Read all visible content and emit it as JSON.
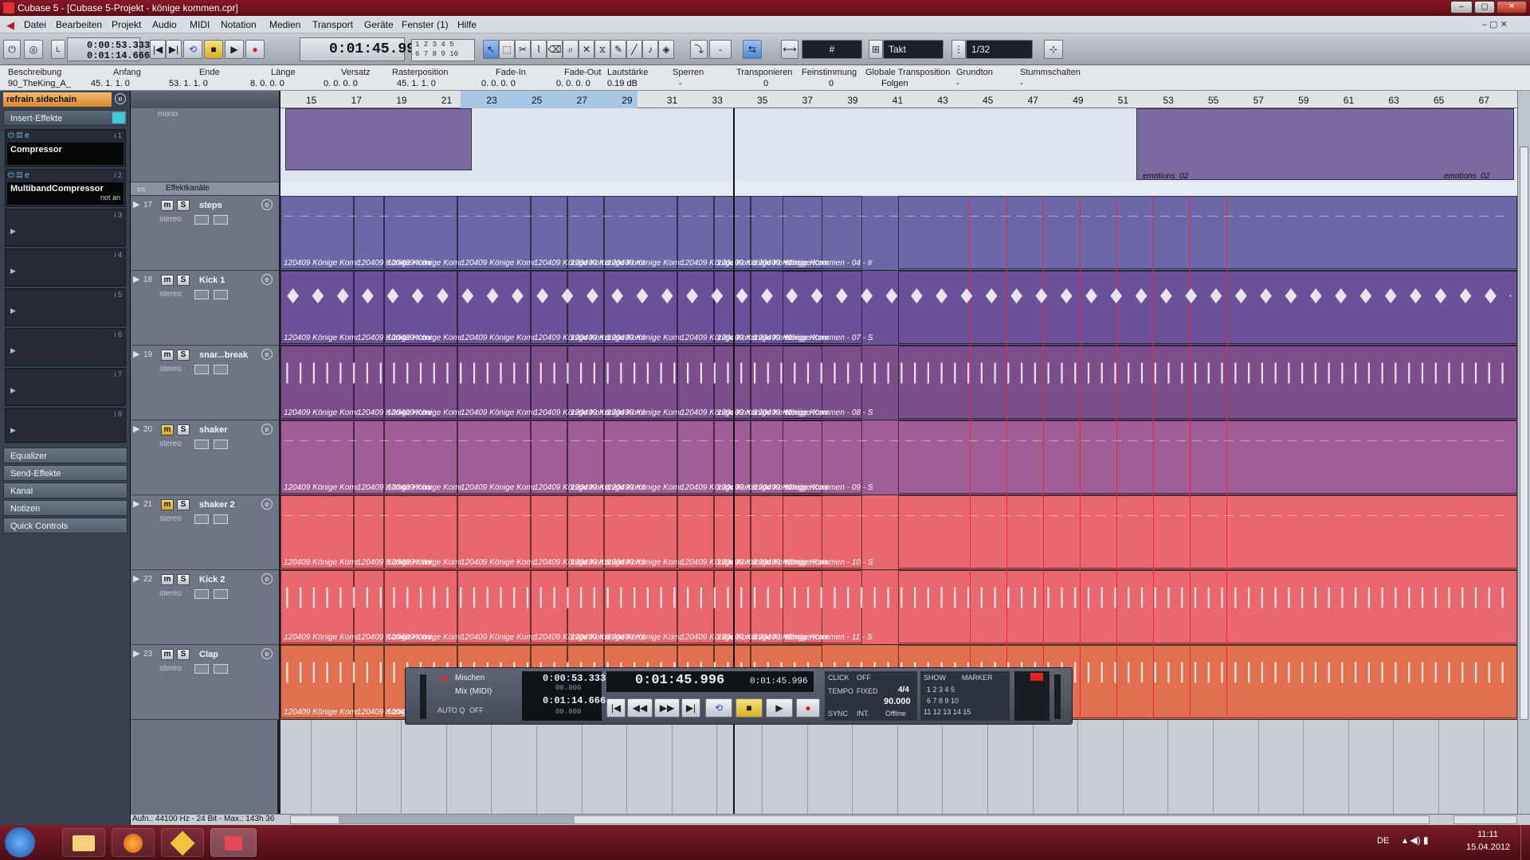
{
  "window": {
    "title": "Cubase 5 - [Cubase 5-Projekt - könige kommen.cpr]"
  },
  "menu": [
    "Datei",
    "Bearbeiten",
    "Projekt",
    "Audio",
    "MIDI",
    "Notation",
    "Medien",
    "Transport",
    "Geräte",
    "Fenster (1)",
    "Hilfe"
  ],
  "toolbar": {
    "pos_left_top": "0:00:53.333",
    "pos_left_bottom": "0:01:14.666",
    "main_time": "0:01:45.996",
    "num_grid_top": "1 2 3 4 5",
    "num_grid_bottom": "6 7 8 9 10",
    "snap_mode": "Takt",
    "quantize": "1/32",
    "nudge": "-"
  },
  "infoline": {
    "headers": [
      "Beschreibung",
      "Anfang",
      "Ende",
      "Länge",
      "Versatz",
      "Rasterposition",
      "Fade-In",
      "Fade-Out",
      "Lautstärke",
      "Sperren",
      "Transponieren",
      "Feinstimmung",
      "Globale Transposition",
      "Grundton",
      "Stummschalten"
    ],
    "values": [
      "90_TheKing_A_",
      "45. 1. 1.   0",
      "53. 1. 1.   0",
      "8. 0. 0.   0",
      "0. 0. 0.   0",
      "45. 1. 1.   0",
      "0. 0. 0.   0",
      "0. 0. 0.   0",
      "0.19 dB",
      "-",
      "0",
      "0",
      "Folgen",
      "-",
      "-"
    ]
  },
  "inspector": {
    "track_name": "refrain sidechain",
    "insert_effects": "Insert-Effekte",
    "slot1_plugin": "Compressor",
    "slot1_num": "i 1",
    "slot2_plugin": "MultibandCompressor",
    "slot2_status": "not an",
    "slot2_num": "i 2",
    "slots_empty": [
      "i 3",
      "i 4",
      "i 5",
      "i 6",
      "i 7",
      "i 8"
    ],
    "sections": [
      "Equalizer",
      "Send-Effekte",
      "Kanal",
      "Notizen",
      "Quick Controls"
    ]
  },
  "tracks_header": {
    "mono_label": "mono",
    "fx_channels": "Effektkanäle"
  },
  "tracks": [
    {
      "num": "17",
      "name": "steps",
      "type": "stereo",
      "mute_on": false,
      "color": "#6c68a8",
      "clip_label": "120409 Könige Komr",
      "long_label": "Könige Kommen - 04 - Ir"
    },
    {
      "num": "18",
      "name": "Kick 1",
      "type": "stereo",
      "mute_on": false,
      "color": "#6b519a",
      "clip_label": "120409 Könige Komr",
      "long_label": "Könige Kommen - 07 - S"
    },
    {
      "num": "19",
      "name": "snar...break",
      "type": "stereo",
      "mute_on": false,
      "color": "#7a4f8c",
      "clip_label": "120409 Könige Komr",
      "long_label": "Könige Kommen - 08 - S"
    },
    {
      "num": "20",
      "name": "shaker",
      "type": "stereo",
      "mute_on": true,
      "color": "#a05d96",
      "clip_label": "120409 Könige Komr",
      "long_label": "Könige Kommen - 09 - S"
    },
    {
      "num": "21",
      "name": "shaker 2",
      "type": "stereo",
      "mute_on": true,
      "color": "#e8686e",
      "clip_label": "120409 Könige Komr",
      "long_label": "Könige Kommen - 10 - S"
    },
    {
      "num": "22",
      "name": "Kick 2",
      "type": "stereo",
      "mute_on": false,
      "color": "#e8686e",
      "clip_label": "120409 Könige Komr",
      "long_label": "Könige Kommen - 11 - S"
    },
    {
      "num": "23",
      "name": "Clap",
      "type": "stereo",
      "mute_on": false,
      "color": "#e07050",
      "clip_label": "120409 Könige Komr",
      "long_label": ""
    }
  ],
  "top_lane": {
    "clip_label_a": "emotions_02",
    "clip_label_b": "emotions_02"
  },
  "ruler": [
    "15",
    "17",
    "19",
    "21",
    "23",
    "25",
    "27",
    "29",
    "31",
    "33",
    "35",
    "37",
    "39",
    "41",
    "43",
    "45",
    "47",
    "49",
    "51",
    "53",
    "55",
    "57",
    "59",
    "61",
    "63",
    "65",
    "67"
  ],
  "right_labels": {
    "k18": "120409 Könige Kommen - 0",
    "k19": "120409 Könige Kommen - 0",
    "k20": "120409 Könige Kommen - 0",
    "k21": "120409 Könige Kommen - 0",
    "k22": "120409 Könige Kommen - 1"
  },
  "transport": {
    "mix_label": "Mischen",
    "mix_midi": "Mix (MIDI)",
    "auto_q": "AUTO Q",
    "auto_q_state": "OFF",
    "left_locator": "0:00:53.333",
    "right_locator": "0:01:14.666",
    "sub_a": "00.000",
    "sub_b": "00.000",
    "main_time": "0:01:45.996",
    "secondary_time": "0:01:45.996",
    "click": "CLICK",
    "click_state": "OFF",
    "tempo": "TEMPO",
    "tempo_mode": "FIXED",
    "signature": "4/4",
    "tempo_value": "90.000",
    "sync": "SYNC",
    "sync_mode": "INT.",
    "sync_state": "Offline",
    "show": "SHOW",
    "marker": "MARKER",
    "marker_row1": "1 2 3 4 5",
    "marker_row2": "6 7 8 9 10",
    "marker_row3": "11 12 13 14 15"
  },
  "statusbar": {
    "text": "Aufn.: 44100 Hz - 24 Bit - Max.: 143h 36"
  },
  "taskbar": {
    "lang": "DE",
    "time": "11:11",
    "date": "15.04.2012"
  },
  "colors": {
    "accent": "#e8283a",
    "title_bg": "#8a1626",
    "purple_lane": "#6c68a8",
    "pink_lane": "#e8686e"
  }
}
